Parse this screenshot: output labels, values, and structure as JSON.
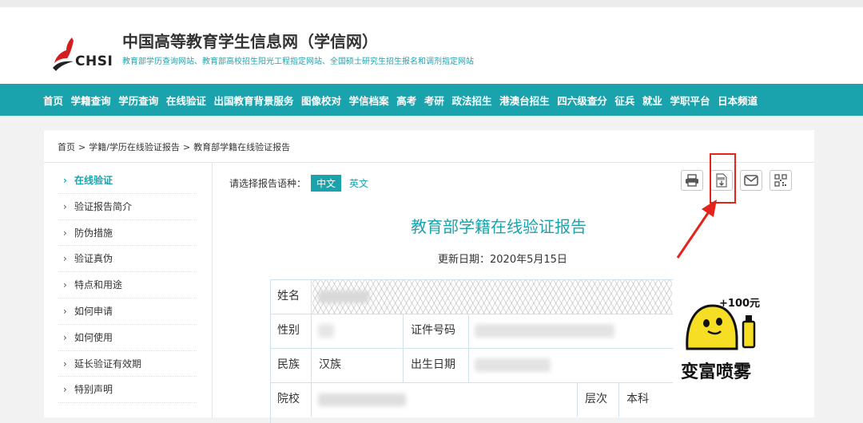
{
  "site": {
    "logo_text": "CHSI",
    "title": "中国高等教育学生信息网（学信网）",
    "subtitle": "教育部学历查询网站、教育部高校招生阳光工程指定网站、全国硕士研究生招生报名和调剂指定网站"
  },
  "nav": [
    "首页",
    "学籍查询",
    "学历查询",
    "在线验证",
    "出国教育背景服务",
    "图像校对",
    "学信档案",
    "高考",
    "考研",
    "政法招生",
    "港澳台招生",
    "四六级查分",
    "征兵",
    "就业",
    "学职平台",
    "日本频道"
  ],
  "breadcrumb": [
    "首页",
    "学籍/学历在线验证报告",
    "教育部学籍在线验证报告"
  ],
  "breadcrumb_sep": ">",
  "sidenav": [
    {
      "label": "在线验证",
      "active": true
    },
    {
      "label": "验证报告简介"
    },
    {
      "label": "防伪措施"
    },
    {
      "label": "验证真伪"
    },
    {
      "label": "特点和用途"
    },
    {
      "label": "如何申请"
    },
    {
      "label": "如何使用"
    },
    {
      "label": "延长验证有效期"
    },
    {
      "label": "特别声明"
    }
  ],
  "arrow_glyph": "›",
  "lang": {
    "label": "请选择报告语种：",
    "zh": "中文",
    "en": "英文"
  },
  "tools": [
    "print-icon",
    "pdf-download-icon",
    "mail-icon",
    "qrcode-icon"
  ],
  "report": {
    "title": "教育部学籍在线验证报告",
    "update": "更新日期：2020年5月15日",
    "fields": {
      "name": "姓名",
      "gender": "性别",
      "id_no": "证件号码",
      "ethnicity": "民族",
      "ethnicity_value": "汉族",
      "birth": "出生日期",
      "school": "院校",
      "level": "层次",
      "level_value": "本科"
    }
  },
  "sticker": {
    "badge": "+100元",
    "caption": "变富喷雾"
  },
  "colors": {
    "teal": "#1aa3ad",
    "red": "#e4231d"
  }
}
